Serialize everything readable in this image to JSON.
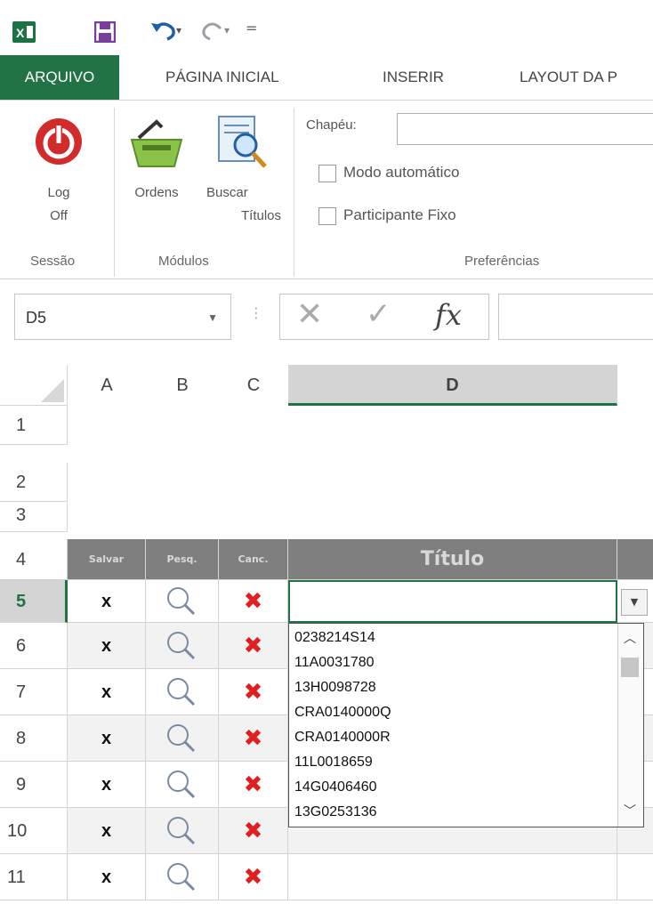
{
  "qat": {
    "excel_icon": "excel-icon",
    "save_icon": "save-icon",
    "undo_icon": "undo-icon",
    "redo_icon": "redo-icon",
    "customize_icon": "customize-icon"
  },
  "tabs": [
    {
      "label": "ARQUIVO"
    },
    {
      "label": "PÁGINA INICIAL"
    },
    {
      "label": "INSERIR"
    },
    {
      "label": "LAYOUT DA P"
    }
  ],
  "ribbon": {
    "session": {
      "logoff_label_1": "Log",
      "logoff_label_2": "Off",
      "group_label": "Sessão"
    },
    "modules": {
      "orders_label": "Ordens",
      "search_label_1": "Buscar",
      "search_label_2": "Títulos",
      "group_label": "Módulos"
    },
    "prefs": {
      "hat_label": "Chapéu:",
      "auto_label": "Modo automático",
      "fixed_label": "Participante Fixo",
      "group_label": "Preferências"
    }
  },
  "formula_bar": {
    "name_box": "D5",
    "fx": "fx"
  },
  "columns": [
    "A",
    "B",
    "C",
    "D"
  ],
  "rows": [
    "1",
    "2",
    "3",
    "4",
    "5",
    "6",
    "7",
    "8",
    "9",
    "10",
    "11"
  ],
  "header_row": {
    "save": "Salvar",
    "search": "Pesq.",
    "cancel": "Canc.",
    "title": "Título"
  },
  "row_marks": {
    "x": "x",
    "cancel": "✖"
  },
  "dropdown": {
    "items": [
      "0238214S14",
      "11A0031780",
      "13H0098728",
      "CRA0140000Q",
      "CRA0140000R",
      "11L0018659",
      "14G0406460",
      "13G0253136"
    ]
  },
  "colors": {
    "ribbon_accent": "#217346",
    "header_gray": "#7f7f7f",
    "cancel_red": "#e02020"
  }
}
